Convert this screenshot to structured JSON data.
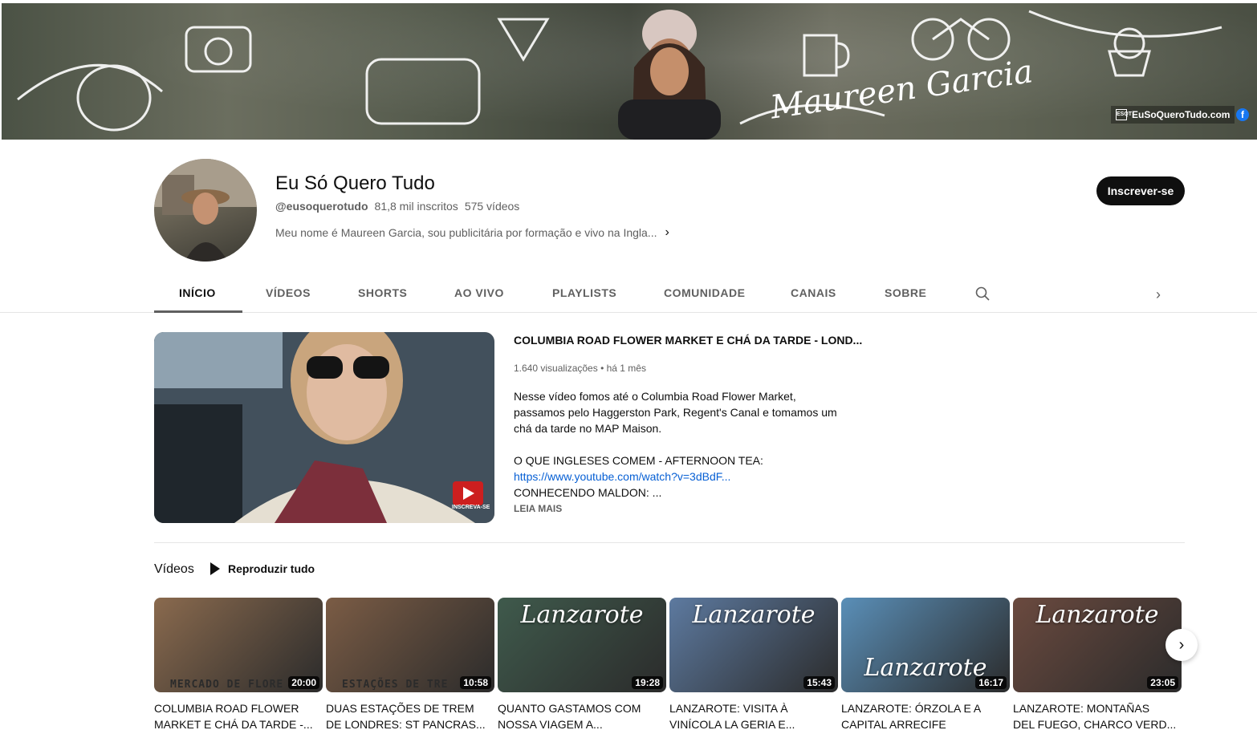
{
  "banner": {
    "name_text": "Maureen Garcia",
    "site_text": "EuSoQueroTudo.com",
    "site_logo_text": "ESQT",
    "facebook_glyph": "f"
  },
  "channel": {
    "name": "Eu Só Quero Tudo",
    "handle": "@eusoquerotudo",
    "subscribers": "81,8 mil inscritos",
    "videos_count": "575 vídeos",
    "description": "Meu nome é Maureen Garcia, sou publicitária por formação e vivo na Ingla...",
    "subscribe_label": "Inscrever-se"
  },
  "tabs": [
    {
      "label": "INÍCIO",
      "active": true
    },
    {
      "label": "VÍDEOS"
    },
    {
      "label": "SHORTS"
    },
    {
      "label": "AO VIVO"
    },
    {
      "label": "PLAYLISTS"
    },
    {
      "label": "COMUNIDADE"
    },
    {
      "label": "CANAIS"
    },
    {
      "label": "SOBRE"
    }
  ],
  "featured": {
    "title": "COLUMBIA ROAD FLOWER MARKET E CHÁ DA TARDE - LOND...",
    "meta": "1.640 visualizações • há 1 mês",
    "desc_lines": [
      "Nesse vídeo fomos até o Columbia Road Flower Market,",
      "passamos pelo Haggerston Park, Regent's Canal e tomamos um",
      "chá da tarde no MAP Maison."
    ],
    "desc_section": "O QUE INGLESES COMEM - AFTERNOON TEA:",
    "desc_link": "https://www.youtube.com/watch?v=3dBdF...",
    "desc_last": "CONHECENDO MALDON: ...",
    "read_more": "LEIA MAIS",
    "subscribe_badge": "INSCREVA-SE"
  },
  "shelf": {
    "title": "Vídeos",
    "play_all": "Reproduzir tudo"
  },
  "videos": [
    {
      "title": "COLUMBIA ROAD FLOWER\nMARKET E CHÁ DA TARDE -...",
      "duration": "20:00",
      "overlay": "",
      "caption": "MERCADO DE FLORE",
      "bg": "#8a6a4e"
    },
    {
      "title": "DUAS ESTAÇÕES DE TREM\nDE LONDRES: ST PANCRAS...",
      "duration": "10:58",
      "overlay": "",
      "caption": "ESTAÇÕES DE TRE",
      "bg": "#7b5c45"
    },
    {
      "title": "QUANTO GASTAMOS COM\nNOSSA VIAGEM A...",
      "duration": "19:28",
      "overlay": "Lanzarote",
      "caption": "",
      "bg": "#3f5a4c"
    },
    {
      "title": "LANZAROTE: VISITA À\nVINÍCOLA LA GERIA E...",
      "duration": "15:43",
      "overlay": "Lanzarote",
      "caption": "",
      "bg": "#5d7aa0"
    },
    {
      "title": "LANZAROTE: ÓRZOLA E A\nCAPITAL ARRECIFE",
      "duration": "16:17",
      "overlay": "Lanzarote",
      "caption": "",
      "bg": "#5a8fb8"
    },
    {
      "title": "LANZAROTE: MONTAÑAS\nDEL FUEGO, CHARCO VERD...",
      "duration": "23:05",
      "overlay": "Lanzarote",
      "caption": "",
      "bg": "#6b4a3f"
    }
  ]
}
